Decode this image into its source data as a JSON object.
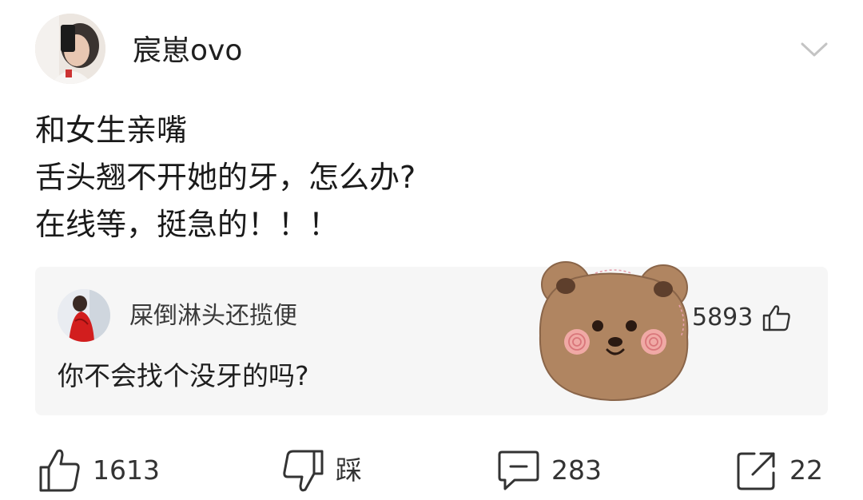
{
  "author": {
    "name": "宸崽ovo",
    "avatar_icon": "avatar-photo"
  },
  "post": {
    "lines": [
      "和女生亲嘴",
      "舌头翘不开她的牙，怎么办?",
      "在线等，挺急的！！！"
    ]
  },
  "hot_comment": {
    "user": "屎倒淋头还揽便",
    "text": "你不会找个没牙的吗?",
    "likes": "5893",
    "like_icon": "thumbs-up-icon"
  },
  "sticker": {
    "icon": "bear-face-sticker"
  },
  "actions": {
    "like_count": "1613",
    "dislike_label": "踩",
    "comment_count": "283",
    "share_count": "22"
  },
  "colors": {
    "background": "#ffffff",
    "card_background": "#f6f6f6",
    "text_primary": "#1a1a1a",
    "icon_stroke": "#333333",
    "bear_fill": "#b08561"
  }
}
